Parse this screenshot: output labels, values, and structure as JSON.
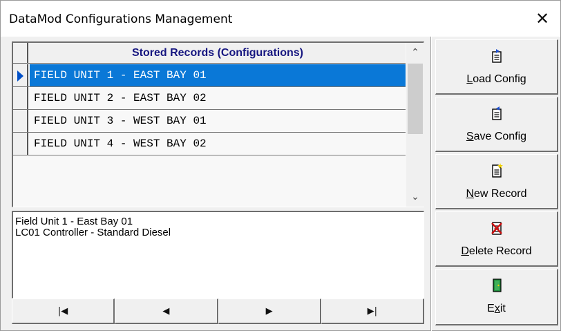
{
  "window": {
    "title": "DataMod Configurations Management",
    "close_glyph": "✕"
  },
  "grid": {
    "header": "Stored Records (Configurations)",
    "rows": [
      "FIELD UNIT 1 - EAST BAY 01",
      "FIELD UNIT 2 - EAST BAY 02",
      "FIELD UNIT 3 - WEST BAY 01",
      "FIELD UNIT 4 - WEST BAY 02"
    ],
    "selected_index": 0,
    "scroll_up_glyph": "⌃",
    "scroll_down_glyph": "⌄"
  },
  "description": {
    "line1": "Field Unit 1 - East Bay 01",
    "line2": "LC01 Controller - Standard Diesel"
  },
  "navigation": {
    "first": "|◀",
    "prev": "◀",
    "next": "▶",
    "last": "▶|"
  },
  "buttons": {
    "load": {
      "hotkey": "L",
      "rest": "oad Config"
    },
    "save": {
      "hotkey": "S",
      "rest": "ave Config"
    },
    "new": {
      "hotkey": "N",
      "rest": "ew Record"
    },
    "delete": {
      "hotkey": "D",
      "rest": "elete Record"
    },
    "exit": {
      "pre": "E",
      "hotkey": "x",
      "rest": "it"
    }
  },
  "colors": {
    "selection": "#0a78d7",
    "header_text": "#161680",
    "row_marker": "#0050c8"
  }
}
